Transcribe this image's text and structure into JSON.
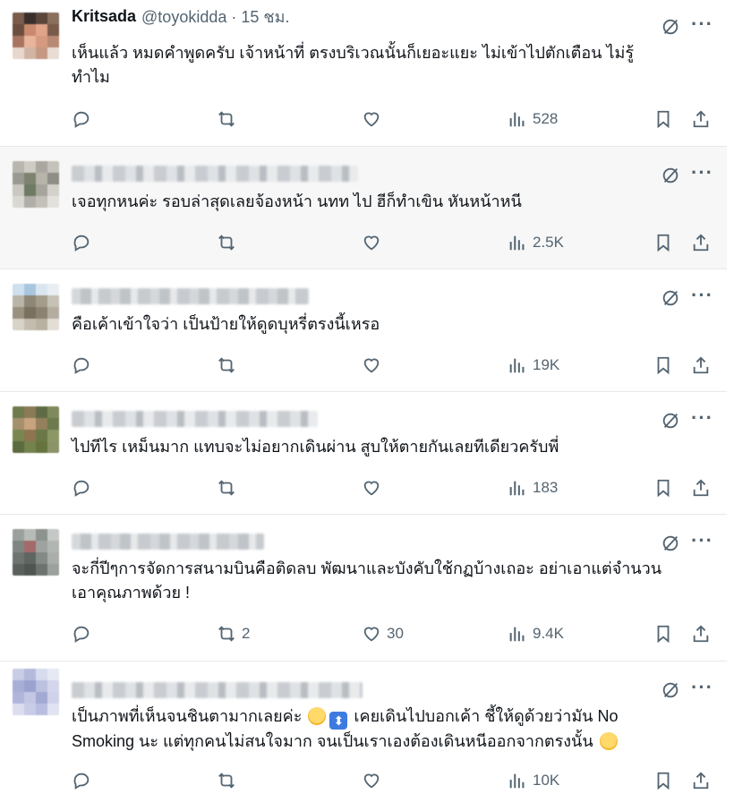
{
  "posts": [
    {
      "name": "Kritsada",
      "handle": "@toyokidda · 15 ชม.",
      "text": "เห็นแล้ว หมดคำพูดครับ เจ้าหน้าที่ ตรงบริเวณนั้นก็เยอะแยะ ไม่เข้าไปตักเตือน ไม่รู้\nทำไม",
      "replies": "",
      "reposts": "",
      "likes": "",
      "views": "528"
    },
    {
      "text": "เจอทุกหนค่ะ รอบล่าสุดเลยจ้องหน้า นทท ไป ฮีก็ทำเขิน หันหน้าหนี",
      "replies": "",
      "reposts": "",
      "likes": "",
      "views": "2.5K"
    },
    {
      "text": "คือเค้าเข้าใจว่า เป็นป้ายให้ดูดบุหรี่ตรงนี้เหรอ",
      "replies": "",
      "reposts": "",
      "likes": "",
      "views": "19K"
    },
    {
      "text": "ไปทีไร เหม็นมาก แทบจะไม่อยากเดินผ่าน สูบให้ตายกันเลยทีเดียวครับพี่",
      "replies": "",
      "reposts": "",
      "likes": "",
      "views": "183"
    },
    {
      "text": "จะกี่ปีๆการจัดการสนามบินคือติดลบ พัฒนาและบังคับใช้กฏบ้างเถอะ อย่าเอาแต่จำนวน\nเอาคุณภาพด้วย !",
      "replies": "",
      "reposts": "2",
      "likes": "30",
      "views": "9.4K"
    },
    {
      "text_part1": "เป็นภาพที่เห็นจนชินตามากเลยค่ะ ",
      "text_part2": " เคยเดินไปบอกเค้า ชี้ให้ดูด้วยว่ามัน No\nSmoking นะ แต่ทุกคนไม่สนใจมาก จนเป็นเราเองต้องเดินหนีออกจากตรงนั้น ",
      "emojis": [
        "slightly-smiling-face",
        "up-down-arrow",
        "face-holding-back-tears"
      ],
      "replies": "",
      "reposts": "",
      "likes": "",
      "views": "10K"
    }
  ],
  "icons": {
    "reply": "reply-icon",
    "repost": "repost-icon",
    "like": "like-icon",
    "views": "views-icon",
    "bookmark": "bookmark-icon",
    "share": "share-icon",
    "grok": "grok-icon",
    "more": "more-icon"
  },
  "colors": {
    "text": "#0f1419",
    "muted": "#536471",
    "divider": "#e6e9ec",
    "hover_bg": "#f7f7f7"
  }
}
